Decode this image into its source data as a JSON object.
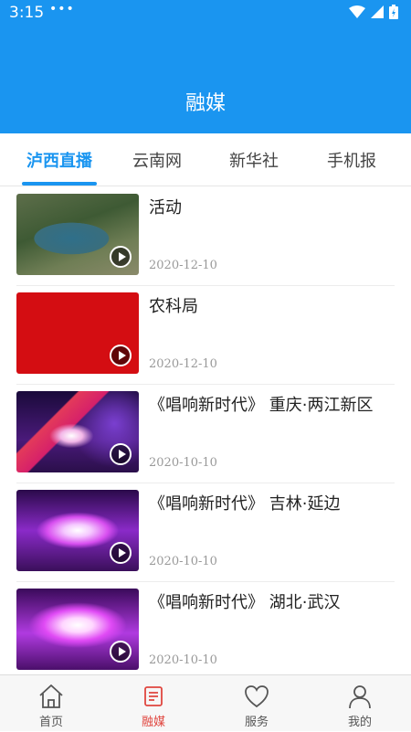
{
  "statusbar": {
    "time": "3:15",
    "dots": "•••"
  },
  "header": {
    "title": "融媒"
  },
  "colors": {
    "accent": "#1a95f0",
    "active_nav": "#e0463f"
  },
  "tabs": [
    {
      "label": "泸西直播",
      "active": true
    },
    {
      "label": "云南网",
      "active": false
    },
    {
      "label": "新华社",
      "active": false
    },
    {
      "label": "手机报",
      "active": false
    }
  ],
  "items": [
    {
      "title": "活动",
      "date": "2020-12-10",
      "thumb": "lake-aerial",
      "icon": "play-icon"
    },
    {
      "title": "农科局",
      "date": "2020-12-10",
      "thumb": "red-solid",
      "icon": "play-icon"
    },
    {
      "title": "《唱响新时代》 重庆·两江新区",
      "date": "2020-10-10",
      "thumb": "stage-flag",
      "icon": "play-icon"
    },
    {
      "title": "《唱响新时代》 吉林·延边",
      "date": "2020-10-10",
      "thumb": "stage-purple",
      "icon": "play-icon"
    },
    {
      "title": "《唱响新时代》  湖北·武汉",
      "date": "2020-10-10",
      "thumb": "stage-magenta",
      "icon": "play-icon"
    }
  ],
  "bottom_nav": [
    {
      "label": "首页",
      "icon": "home-icon",
      "active": false
    },
    {
      "label": "融媒",
      "icon": "media-icon",
      "active": true
    },
    {
      "label": "服务",
      "icon": "heart-icon",
      "active": false
    },
    {
      "label": "我的",
      "icon": "user-icon",
      "active": false
    }
  ]
}
